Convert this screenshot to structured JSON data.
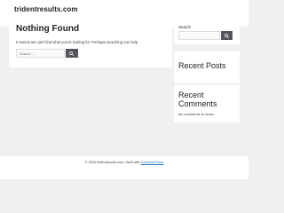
{
  "header": {
    "site_title": "tridentresults.com"
  },
  "main": {
    "title": "Nothing Found",
    "message": "It seems we can't find what you're looking for. Perhaps searching can help.",
    "search": {
      "placeholder": "Search ...",
      "value": ""
    },
    "search_icon": "search-icon"
  },
  "sidebar": {
    "search_widget": {
      "label": "Search",
      "value": "",
      "icon": "search-icon"
    },
    "recent_posts": {
      "title": "Recent Posts"
    },
    "recent_comments": {
      "title": "Recent Comments",
      "empty_text": "No comments to show."
    }
  },
  "footer": {
    "copyright": "© 2025 tridentresults.com • Built with ",
    "link_label": "GeneratePress"
  },
  "colors": {
    "background": "#f0f0f0",
    "card": "#ffffff",
    "button": "#55555e",
    "link": "#1e73be",
    "text": "#222222"
  }
}
